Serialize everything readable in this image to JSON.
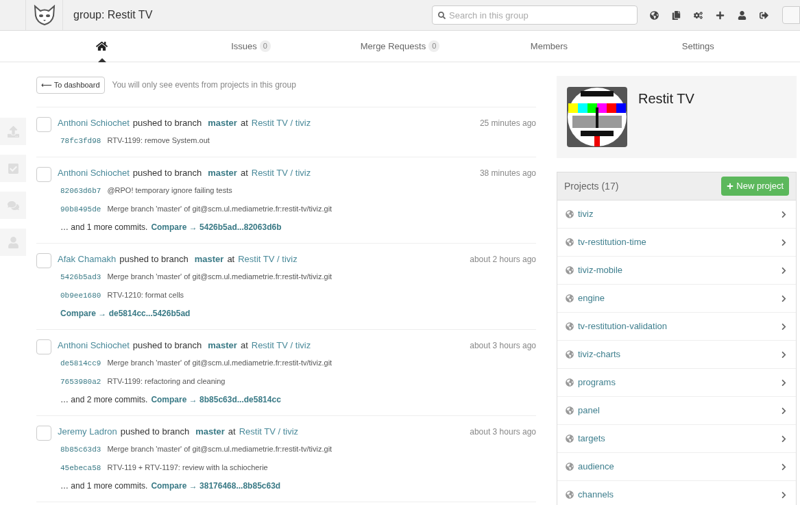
{
  "header": {
    "title": "group: Restit TV",
    "search": {
      "placeholder": "Search in this group"
    }
  },
  "nav": [
    {
      "kind": "home",
      "selected": true
    },
    {
      "kind": "tab",
      "label": "Issues",
      "count": "0",
      "selected": false
    },
    {
      "kind": "tab",
      "label": "Merge Requests",
      "count": "0",
      "selected": false
    },
    {
      "kind": "tab",
      "label": "Members",
      "selected": false
    },
    {
      "kind": "tab",
      "label": "Settings",
      "selected": false
    }
  ],
  "dashboard_button": "⟵ To dashboard",
  "hint": "You will only see events from projects in this group",
  "events": [
    {
      "author": "Anthoni Schiochet",
      "action": "pushed to branch",
      "branch": "master",
      "at": "at",
      "project": "Restit TV / tiviz",
      "time": "25 minutes ago",
      "commits": [
        {
          "sha": "78fc3fd98",
          "message": "RTV-1199: remove System.out"
        }
      ]
    },
    {
      "author": "Anthoni Schiochet",
      "action": "pushed to branch",
      "branch": "master",
      "at": "at",
      "project": "Restit TV / tiviz",
      "time": "38 minutes ago",
      "commits": [
        {
          "sha": "82063d6b7",
          "message": "@RPO! temporary ignore failing tests"
        },
        {
          "sha": "90b8495de",
          "message": "Merge branch 'master' of git@scm.ul.mediametrie.fr:restit-tv/tiviz.git"
        }
      ],
      "more": "… and 1 more commits.",
      "compare": "Compare → 5426b5ad...82063d6b"
    },
    {
      "author": "Afak Chamakh",
      "action": "pushed to branch",
      "branch": "master",
      "at": "at",
      "project": "Restit TV / tiviz",
      "time": "about 2 hours ago",
      "commits": [
        {
          "sha": "5426b5ad3",
          "message": "Merge branch 'master' of git@scm.ul.mediametrie.fr:restit-tv/tiviz.git"
        },
        {
          "sha": "0b9ee1680",
          "message": "RTV-1210: format cells"
        }
      ],
      "compare": "Compare → de5814cc...5426b5ad"
    },
    {
      "author": "Anthoni Schiochet",
      "action": "pushed to branch",
      "branch": "master",
      "at": "at",
      "project": "Restit TV / tiviz",
      "time": "about 3 hours ago",
      "commits": [
        {
          "sha": "de5814cc9",
          "message": "Merge branch 'master' of git@scm.ul.mediametrie.fr:restit-tv/tiviz.git"
        },
        {
          "sha": "7653980a2",
          "message": "RTV-1199: refactoring and cleaning"
        }
      ],
      "more": "… and 2 more commits.",
      "compare": "Compare → 8b85c63d...de5814cc"
    },
    {
      "author": "Jeremy Ladron",
      "action": "pushed to branch",
      "branch": "master",
      "at": "at",
      "project": "Restit TV / tiviz",
      "time": "about 3 hours ago",
      "commits": [
        {
          "sha": "8b85c63d3",
          "message": "Merge branch 'master' of git@scm.ul.mediametrie.fr:restit-tv/tiviz.git"
        },
        {
          "sha": "45ebeca58",
          "message": "RTV-119 + RTV-1197: review with la schiocherie"
        }
      ],
      "more": "… and 1 more commits.",
      "compare": "Compare → 38176468...8b85c63d"
    }
  ],
  "group": {
    "name": "Restit TV"
  },
  "projects": {
    "title": "Projects (17)",
    "new_button": "New project",
    "items": [
      "tiviz",
      "tv-restitution-time",
      "tiviz-mobile",
      "engine",
      "tv-restitution-validation",
      "tiviz-charts",
      "programs",
      "panel",
      "targets",
      "audience",
      "channels"
    ]
  }
}
